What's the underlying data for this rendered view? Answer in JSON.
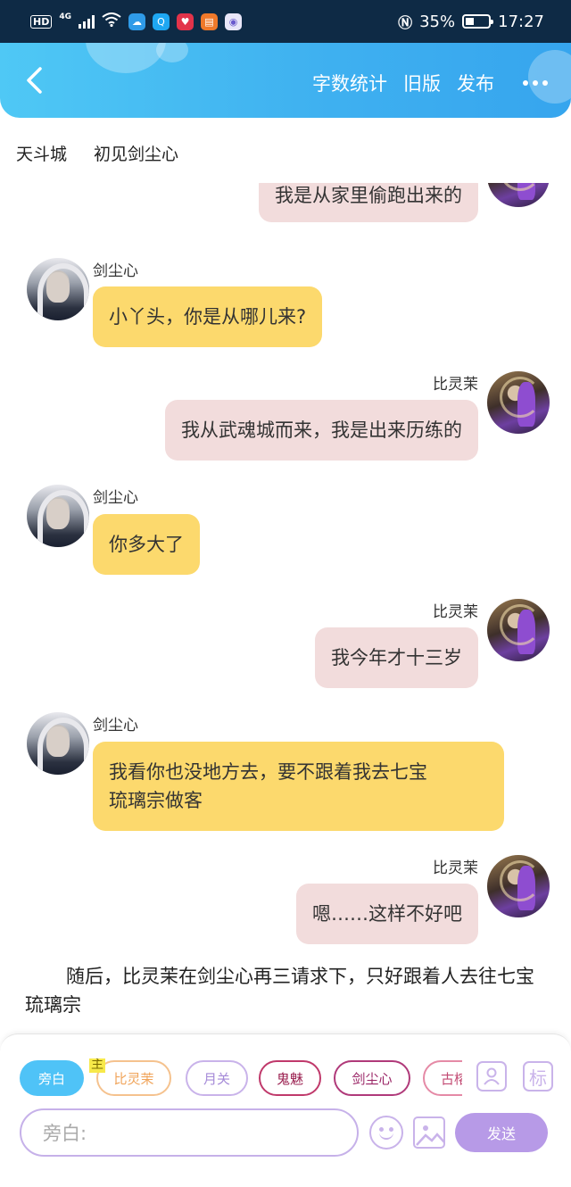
{
  "status_bar": {
    "network": "HD",
    "network_type": "4G",
    "battery": "35%",
    "time": "17:27",
    "app_icons": [
      "weather-icon",
      "search-app-icon",
      "heart-app-icon",
      "grid-app-icon",
      "photo-app-icon"
    ]
  },
  "header": {
    "actions": {
      "word_count": "字数统计",
      "old_version": "旧版",
      "publish": "发布"
    },
    "accent": "#3fb1f0"
  },
  "breadcrumb": {
    "location": "天斗城",
    "chapter": "初见剑尘心"
  },
  "messages": [
    {
      "speaker": "",
      "text": "我是从家里偷跑出来的",
      "side": "right"
    },
    {
      "speaker": "剑尘心",
      "text": "小丫头，你是从哪儿来?",
      "side": "left"
    },
    {
      "speaker": "比灵茉",
      "text": "我从武魂城而来，我是出来历练的",
      "side": "right"
    },
    {
      "speaker": "剑尘心",
      "text": "你多大了",
      "side": "left"
    },
    {
      "speaker": "比灵茉",
      "text": "我今年才十三岁",
      "side": "right"
    },
    {
      "speaker": "剑尘心",
      "text_line1": "我看你也没地方去，要不跟着我去七宝",
      "text_line2": "琉璃宗做客",
      "side": "left"
    },
    {
      "speaker": "比灵茉",
      "text": "嗯……这样不好吧",
      "side": "right"
    }
  ],
  "narration": "随后，比灵茉在剑尘心再三请求下，只好跟着人去往七宝琉璃宗",
  "composer": {
    "roles": [
      "旁白",
      "比灵茉",
      "月关",
      "鬼魅",
      "剑尘心",
      "古榕"
    ],
    "main_tag": "主",
    "input_placeholder": "旁白:",
    "send_label": "发送",
    "tag_icon_label": "标"
  },
  "colors": {
    "left_bubble": "#fcd96d",
    "right_bubble": "#f2dcdc",
    "send_button": "#b79ae7"
  }
}
